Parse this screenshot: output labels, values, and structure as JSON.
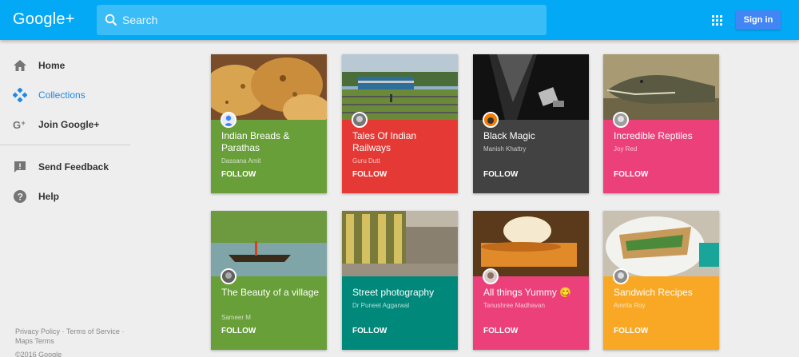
{
  "header": {
    "logo": "Google+",
    "search_placeholder": "Search",
    "signin_label": "Sign in",
    "brand_color": "#03a9f4"
  },
  "sidebar": {
    "items": [
      {
        "label": "Home",
        "icon": "home-icon"
      },
      {
        "label": "Collections",
        "icon": "collections-icon",
        "active": true
      },
      {
        "label": "Join Google+",
        "icon": "google-plus-icon"
      },
      {
        "label": "Send Feedback",
        "icon": "feedback-icon"
      },
      {
        "label": "Help",
        "icon": "help-icon"
      }
    ],
    "footer_links": "Privacy Policy · Terms of Service · Maps Terms",
    "copyright": "©2016 Google"
  },
  "collections": [
    {
      "title": "Indian Breads & Parathas",
      "author": "Dassana Amit",
      "follow": "FOLLOW",
      "color": "#689f38"
    },
    {
      "title": "Tales Of Indian Railways",
      "author": "Guru Dutt",
      "follow": "FOLLOW",
      "color": "#e53935"
    },
    {
      "title": "Black Magic",
      "author": "Manish Khattry",
      "follow": "FOLLOW",
      "color": "#424242"
    },
    {
      "title": "Incredible Reptiles",
      "author": "Joy Red",
      "follow": "FOLLOW",
      "color": "#ec407a"
    },
    {
      "title": "The Beauty of a village",
      "author": "Sameer M",
      "follow": "FOLLOW",
      "color": "#689f38"
    },
    {
      "title": "Street photography",
      "author": "Dr Puneet Aggarwal",
      "follow": "FOLLOW",
      "color": "#00897b"
    },
    {
      "title": "All things Yummy 😋",
      "author": "Tanushree Madhavan",
      "follow": "FOLLOW",
      "color": "#ec407a"
    },
    {
      "title": "Sandwich Recipes",
      "author": "Amrita Roy",
      "follow": "FOLLOW",
      "color": "#f9a825"
    }
  ]
}
